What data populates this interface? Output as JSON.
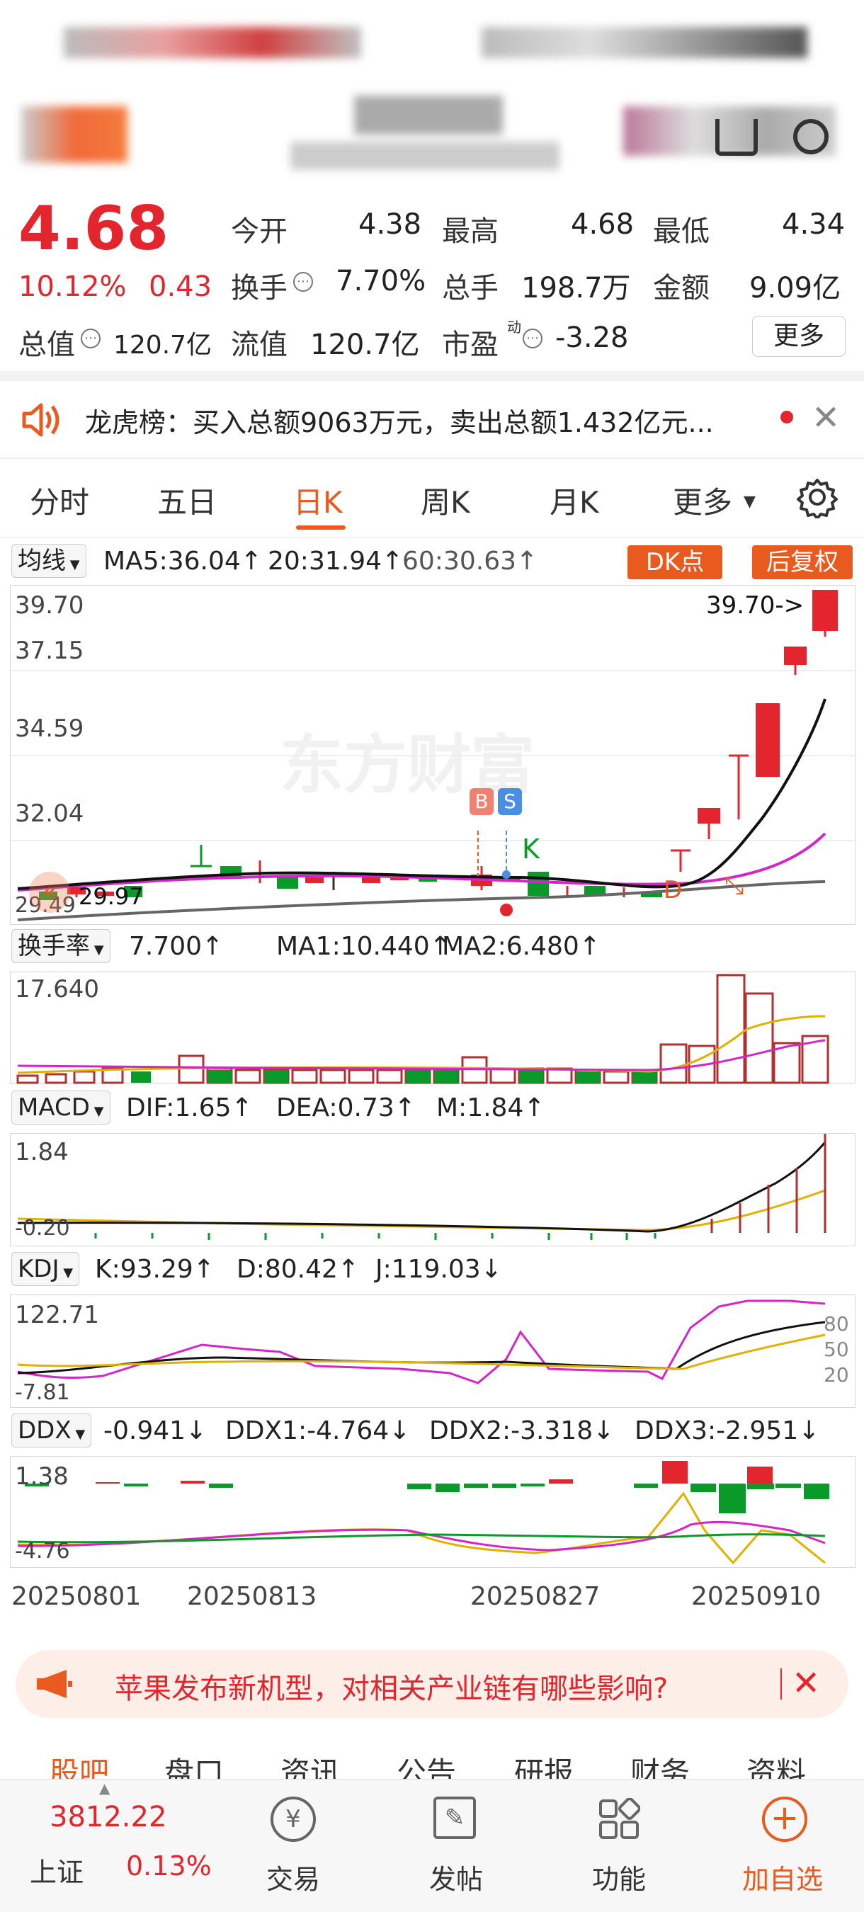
{
  "quote": {
    "price": "4.68",
    "change_pct": "10.12%",
    "change_abs": "0.43",
    "open_label": "今开",
    "open": "4.38",
    "high_label": "最高",
    "high": "4.68",
    "low_label": "最低",
    "low": "4.34",
    "turnover_label": "换手",
    "turnover": "7.70%",
    "volume_label": "总手",
    "volume": "198.7万",
    "amount_label": "金额",
    "amount": "9.09亿",
    "mktcap_label": "总值",
    "mktcap": "120.7亿",
    "float_label": "流值",
    "float": "120.7亿",
    "pe_label": "市盈",
    "pe_sup": "动",
    "pe": "-3.28",
    "more_label": "更多"
  },
  "notice": {
    "text": "龙虎榜：买入总额9063万元，卖出总额1.432亿元..."
  },
  "period_tabs": [
    "分时",
    "五日",
    "日K",
    "周K",
    "月K",
    "更多"
  ],
  "period_active": "日K",
  "kline": {
    "ma_button": "均线",
    "ma5": "MA5:36.04↑",
    "ma20": "20:31.94↑",
    "ma60": "60:30.63↑",
    "dk_label": "DK点",
    "adj_label": "后复权",
    "y_ticks": [
      "39.70",
      "37.15",
      "34.59",
      "32.04",
      "29.49"
    ],
    "max_label": "39.70->",
    "min_label": "29.97",
    "watermark": "东方财富",
    "b_marker": "B",
    "s_marker": "S",
    "k_marker": "K",
    "d_marker": "D"
  },
  "turnover_panel": {
    "button": "换手率",
    "value": "7.700↑",
    "ma1": "MA1:10.440↑",
    "ma2": "MA2:6.480↑",
    "y_top": "17.640"
  },
  "macd_panel": {
    "button": "MACD",
    "dif": "DIF:1.65↑",
    "dea": "DEA:0.73↑",
    "m": "M:1.84↑",
    "y_top": "1.84",
    "y_bottom": "-0.20"
  },
  "kdj_panel": {
    "button": "KDJ",
    "k": "K:93.29↑",
    "d": "D:80.42↑",
    "j": "J:119.03↓",
    "y_top": "122.71",
    "y_bottom": "-7.81",
    "levels": [
      "80",
      "50",
      "20"
    ]
  },
  "ddx_panel": {
    "button": "DDX",
    "ddx": "-0.941↓",
    "ddx1": "DDX1:-4.764↓",
    "ddx2": "DDX2:-3.318↓",
    "ddx3": "DDX3:-2.951↓",
    "y_top": "1.38",
    "y_bottom": "-4.76"
  },
  "dates": [
    "20250801",
    "20250813",
    "20250827",
    "20250910"
  ],
  "promo": {
    "text": "苹果发布新机型，对相关产业链有哪些影响?"
  },
  "sub_tabs": [
    "股吧",
    "盘口",
    "资讯",
    "公告",
    "研报",
    "财务",
    "资料"
  ],
  "bottom": {
    "index_value": "3812.22",
    "index_name": "上证",
    "index_change": "0.13%",
    "trade": "交易",
    "post": "发帖",
    "func": "功能",
    "add": "加自选"
  },
  "colors": {
    "up": "#e3262d",
    "down": "#0a9a2a",
    "accent": "#e85a1e",
    "ma5": "#111111",
    "ma20": "#d426c8",
    "ma60": "#666666",
    "gold": "#e2b000"
  }
}
